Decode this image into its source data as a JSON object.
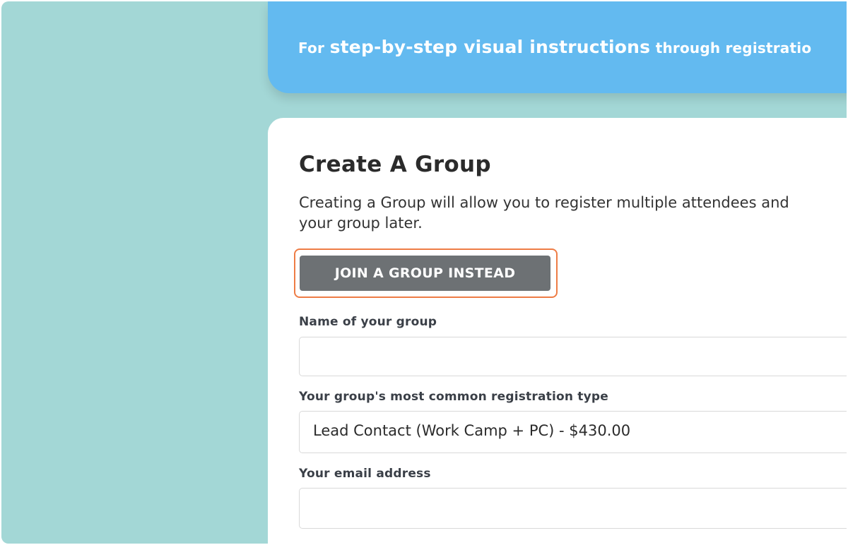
{
  "banner": {
    "prefix": "For",
    "emphasis": "step-by-step visual instructions",
    "suffix": "through registratio"
  },
  "form": {
    "title": "Create A Group",
    "description_line1": "Creating a Group will allow you to register multiple attendees and",
    "description_line2": "your group later.",
    "join_button_label": "JOIN A GROUP INSTEAD",
    "group_name": {
      "label": "Name of your group",
      "value": ""
    },
    "registration_type": {
      "label": "Your group's most common registration type",
      "value": "Lead Contact (Work Camp + PC) - $430.00"
    },
    "email": {
      "label": "Your email address",
      "value": ""
    }
  },
  "colors": {
    "page_background": "#a3d7d6",
    "banner": "#63baf0",
    "button": "#6d7174",
    "highlight_outline": "#ee7c45"
  }
}
